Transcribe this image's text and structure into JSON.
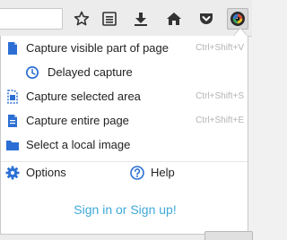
{
  "toolbar": {
    "icons": [
      "star-icon",
      "reading-list-icon",
      "download-icon",
      "home-icon",
      "pocket-icon",
      "screenshot-extension-icon"
    ]
  },
  "menu": {
    "items": [
      {
        "label": "Capture visible part of page",
        "shortcut": "Ctrl+Shift+V",
        "icon": "visible-page-icon"
      },
      {
        "label": "Delayed capture",
        "shortcut": "",
        "icon": "clock-icon"
      },
      {
        "label": "Capture selected area",
        "shortcut": "Ctrl+Shift+S",
        "icon": "selected-area-icon"
      },
      {
        "label": "Capture entire page",
        "shortcut": "Ctrl+Shift+E",
        "icon": "entire-page-icon"
      },
      {
        "label": "Select a local image",
        "shortcut": "",
        "icon": "folder-icon"
      }
    ],
    "options_label": "Options",
    "help_label": "Help",
    "signin_label": "Sign in or Sign up!"
  },
  "colors": {
    "accent": "#2b6fd4",
    "link": "#3fa9d8",
    "shortcut": "#b4b4b4"
  }
}
